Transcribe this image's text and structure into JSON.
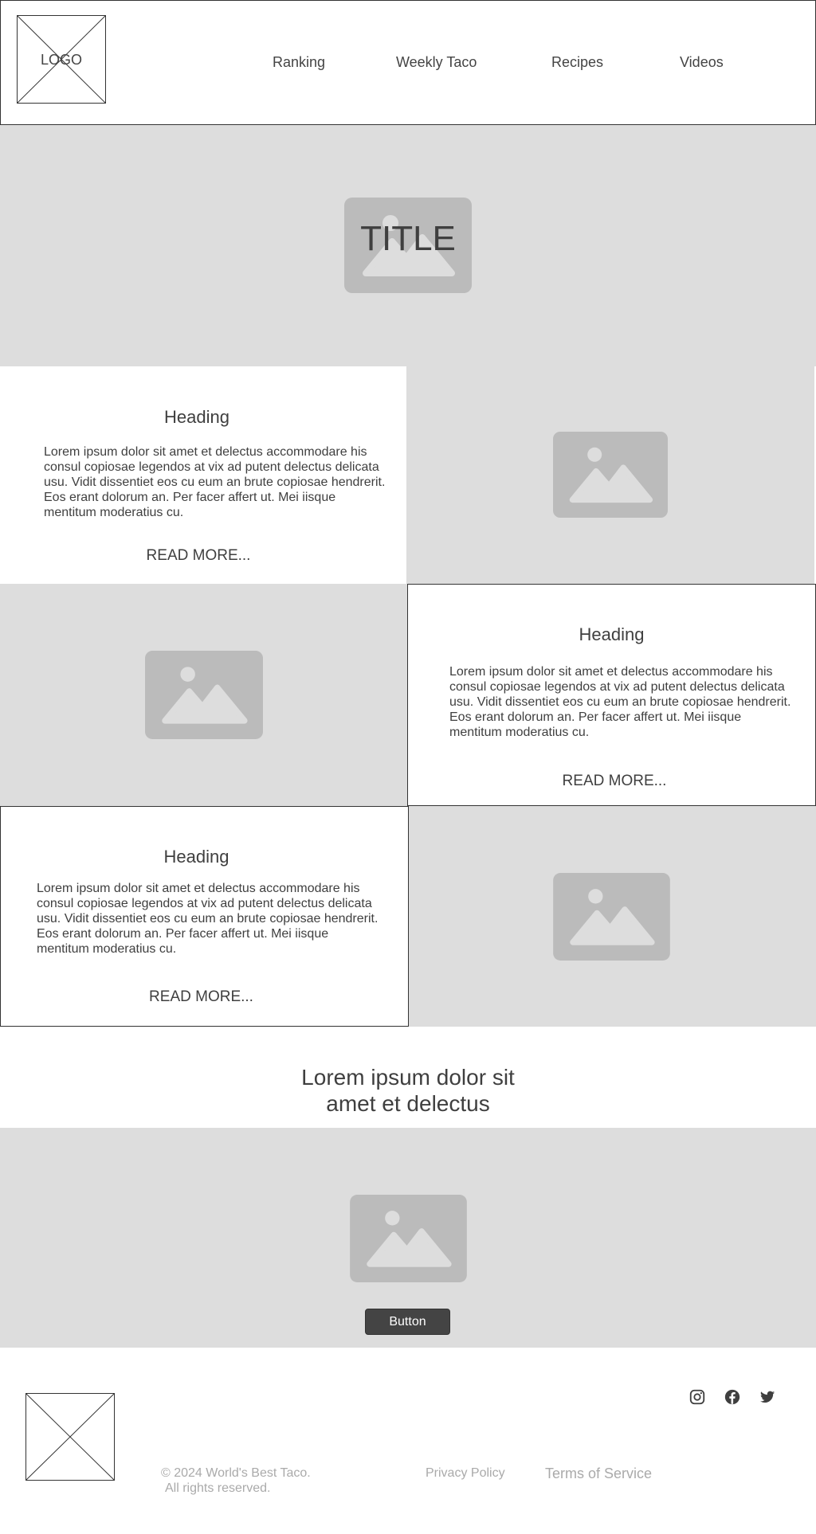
{
  "header": {
    "logo_text": "LOGO",
    "nav": [
      "Ranking",
      "Weekly Taco",
      "Recipes",
      "Videos"
    ]
  },
  "hero": {
    "title": "TITLE"
  },
  "blocks": [
    {
      "heading": "Heading",
      "body": "Lorem ipsum dolor sit amet et delectus accommodare his consul copiosae legendos at vix ad putent delectus delicata usu. Vidit dissentiet eos cu eum an brute copiosae hendrerit. Eos erant dolorum an. Per facer affert ut. Mei iisque mentitum moderatius cu.",
      "link": "READ MORE..."
    },
    {
      "heading": "Heading",
      "body": "Lorem ipsum dolor sit amet et delectus accommodare his consul copiosae legendos at vix ad putent delectus delicata usu. Vidit dissentiet eos cu eum an brute copiosae hendrerit. Eos erant dolorum an. Per facer affert ut. Mei iisque mentitum moderatius cu.",
      "link": "READ MORE..."
    },
    {
      "heading": "Heading",
      "body": "Lorem ipsum dolor sit amet et delectus accommodare his consul copiosae legendos at vix ad putent delectus delicata usu. Vidit dissentiet eos cu eum an brute copiosae hendrerit. Eos erant dolorum an. Per facer affert ut. Mei iisque mentitum moderatius cu.",
      "link": "READ MORE..."
    }
  ],
  "cta": {
    "line1": "Lorem ipsum dolor sit",
    "line2": "amet et delectus",
    "button": "Button"
  },
  "footer": {
    "copyright_line1": "© 2024 World's Best Taco.",
    "copyright_line2": "All rights reserved.",
    "privacy": "Privacy Policy",
    "terms": "Terms of Service",
    "social_icons": [
      "instagram-icon",
      "facebook-icon",
      "twitter-icon"
    ]
  },
  "colors": {
    "placeholder_bg": "#dddddd",
    "placeholder_icon": "#bbbbbb",
    "text": "#3f3f3f",
    "button_bg": "#444444",
    "footer_text": "#aaaaaa"
  }
}
